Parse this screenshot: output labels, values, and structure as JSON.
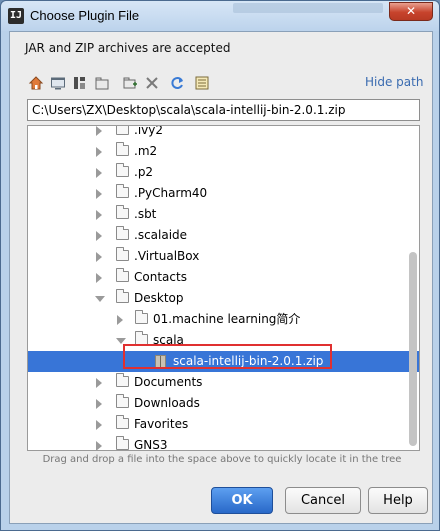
{
  "window": {
    "title": "Choose Plugin File",
    "app_icon_glyph": "IJ",
    "close_glyph": "✕"
  },
  "description": "JAR and ZIP archives are accepted",
  "toolbar": {
    "icons": [
      "home-icon",
      "desktop-icon",
      "project-icon",
      "module-icon",
      "new-folder-icon",
      "delete-icon",
      "refresh-icon",
      "show-hidden-icon"
    ],
    "hide_path_label": "Hide path"
  },
  "path_value": "C:\\Users\\ZX\\Desktop\\scala\\scala-intellij-bin-2.0.1.zip",
  "tree": {
    "items": [
      {
        "label": ".ivy2",
        "expanded": false,
        "type": "folder"
      },
      {
        "label": ".m2",
        "expanded": false,
        "type": "folder"
      },
      {
        "label": ".p2",
        "expanded": false,
        "type": "folder"
      },
      {
        "label": ".PyCharm40",
        "expanded": false,
        "type": "folder"
      },
      {
        "label": ".sbt",
        "expanded": false,
        "type": "folder"
      },
      {
        "label": ".scalaide",
        "expanded": false,
        "type": "folder"
      },
      {
        "label": ".VirtualBox",
        "expanded": false,
        "type": "folder"
      },
      {
        "label": "Contacts",
        "expanded": false,
        "type": "folder"
      },
      {
        "label": "Desktop",
        "expanded": true,
        "type": "folder"
      },
      {
        "label": "01.machine learning简介",
        "expanded": false,
        "type": "folder"
      },
      {
        "label": "scala",
        "expanded": true,
        "type": "folder"
      },
      {
        "label": "scala-intellij-bin-2.0.1.zip",
        "expanded": false,
        "type": "zip",
        "selected": true
      },
      {
        "label": "Documents",
        "expanded": false,
        "type": "folder"
      },
      {
        "label": "Downloads",
        "expanded": false,
        "type": "folder"
      },
      {
        "label": "Favorites",
        "expanded": false,
        "type": "folder"
      },
      {
        "label": "GNS3",
        "expanded": false,
        "type": "folder"
      }
    ]
  },
  "hint": "Drag and drop a file into the space above to quickly locate it in the tree",
  "buttons": {
    "ok": "OK",
    "cancel": "Cancel",
    "help": "Help"
  },
  "colors": {
    "selection": "#3875d7",
    "link": "#3a6bb0",
    "highlight_box": "#e03030"
  }
}
